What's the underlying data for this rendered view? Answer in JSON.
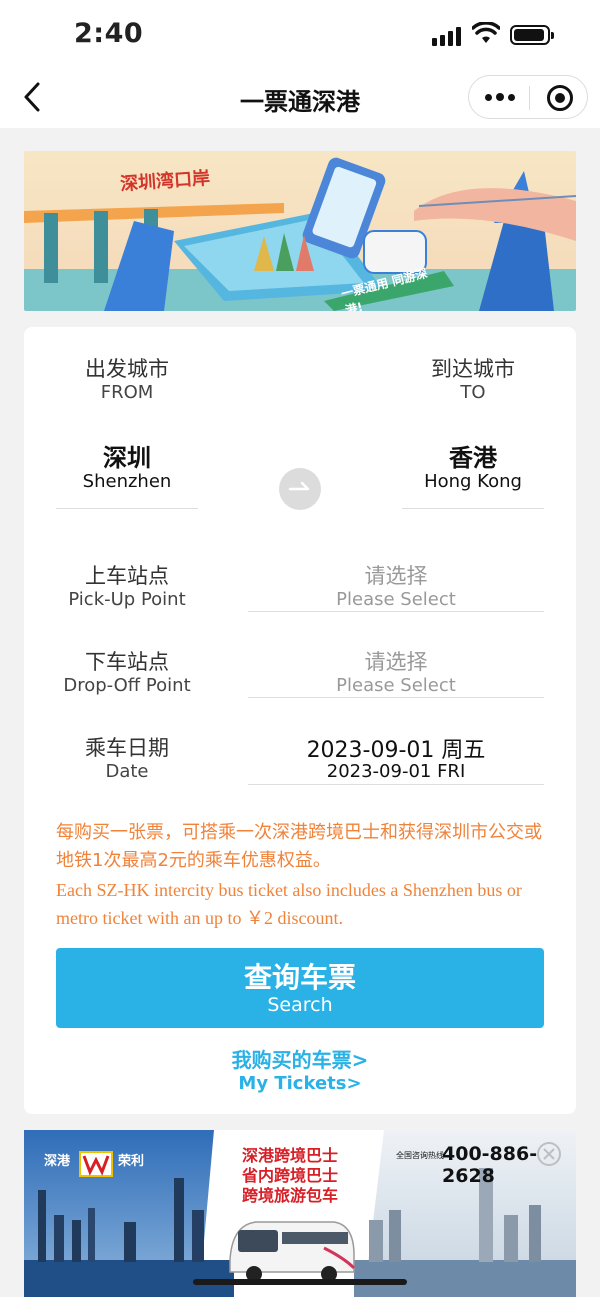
{
  "status_bar": {
    "time": "2:40"
  },
  "nav": {
    "title": "一票通深港"
  },
  "top_banner": {
    "logo_text": "深圳湾口岸",
    "slogan": "一票通用 同游深港!"
  },
  "form": {
    "from": {
      "label_cn": "出发城市",
      "label_en": "FROM",
      "city_cn": "深圳",
      "city_en": "Shenzhen"
    },
    "to": {
      "label_cn": "到达城市",
      "label_en": "TO",
      "city_cn": "香港",
      "city_en": "Hong Kong"
    },
    "pickup": {
      "label_cn": "上车站点",
      "label_en": "Pick-Up Point",
      "value_cn": "请选择",
      "value_en": "Please Select"
    },
    "dropoff": {
      "label_cn": "下车站点",
      "label_en": "Drop-Off Point",
      "value_cn": "请选择",
      "value_en": "Please Select"
    },
    "date": {
      "label_cn": "乘车日期",
      "label_en": "Date",
      "value_cn": "2023-09-01 周五",
      "value_en": "2023-09-01 FRI"
    },
    "notice_cn": "每购买一张票，可搭乘一次深港跨境巴士和获得深圳市公交或地铁1次最高2元的乘车优惠权益。",
    "notice_en": "Each SZ-HK intercity bus ticket also includes a Shenzhen bus or metro ticket with an up to ￥2 discount.",
    "search_cn": "查询车票",
    "search_en": "Search",
    "my_tickets_cn": "我购买的车票>",
    "my_tickets_en": "My Tickets>"
  },
  "ad_banner": {
    "brand": "深港",
    "brand_suffix": "荣利",
    "line1": "深港跨境巴士",
    "line2": "省内跨境巴士",
    "line3": "跨境旅游包车",
    "hotline_label": "全国咨询热线",
    "hotline": "400-886-2628"
  },
  "colors": {
    "accent": "#2ab1e6",
    "notice": "#f0833a",
    "background": "#f2f2f2"
  }
}
